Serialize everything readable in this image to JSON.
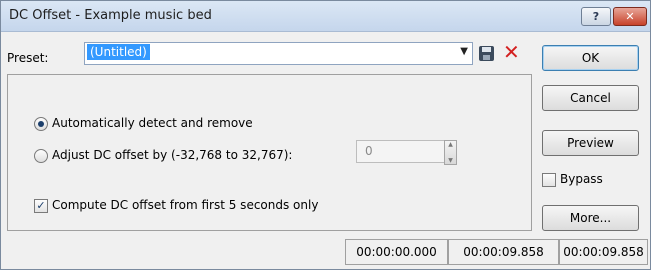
{
  "window": {
    "title": "DC Offset - Example music bed"
  },
  "titlebar": {
    "help_label": "?",
    "close_label": "✕"
  },
  "preset": {
    "label": "Preset:",
    "value": "(Untitled)"
  },
  "buttons": {
    "ok": "OK",
    "cancel": "Cancel",
    "preview": "Preview",
    "more": "More..."
  },
  "bypass": {
    "label": "Bypass",
    "checked": false
  },
  "options": {
    "auto_detect": {
      "label": "Automatically detect and remove",
      "selected": true
    },
    "adjust": {
      "label": "Adjust DC offset by (-32,768 to 32,767):",
      "selected": false,
      "value": "0"
    },
    "compute_first": {
      "label": "Compute DC offset from first 5 seconds only",
      "checked": true
    }
  },
  "status": {
    "start": "00:00:00.000",
    "end": "00:00:09.858",
    "length": "00:00:09.858"
  }
}
